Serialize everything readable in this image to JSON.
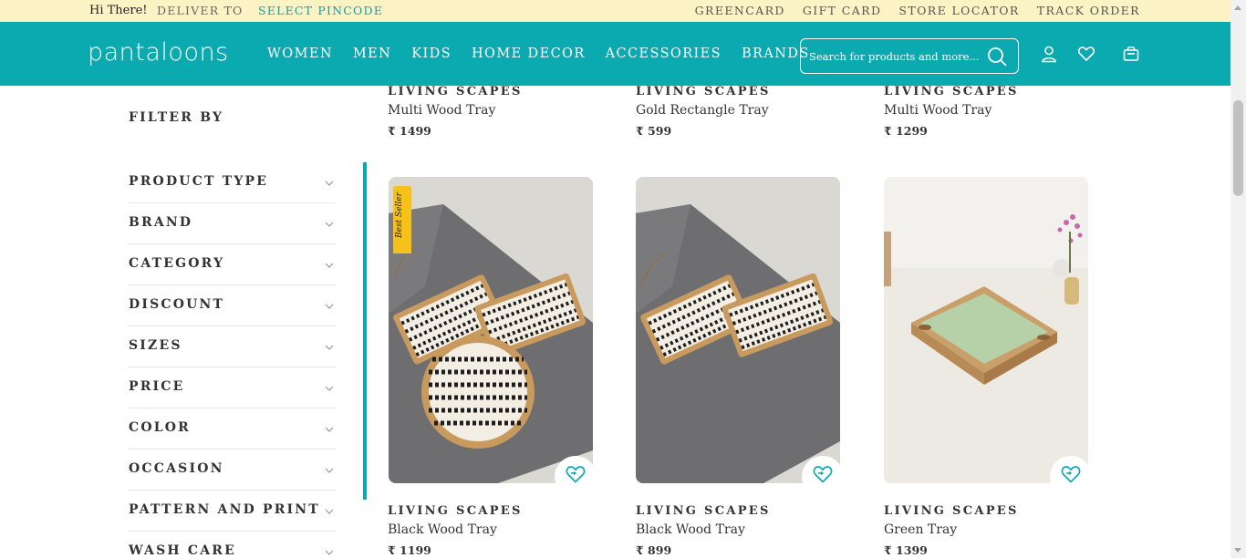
{
  "topbar": {
    "greeting": "Hi There!",
    "deliver_to": "DELIVER TO",
    "select_pincode": "SELECT PINCODE",
    "links": [
      "GREENCARD",
      "GIFT CARD",
      "STORE LOCATOR",
      "TRACK ORDER"
    ]
  },
  "nav": {
    "logo": "pantaloons",
    "menu": [
      "WOMEN",
      "MEN",
      "KIDS",
      "HOME DECOR",
      "ACCESSORIES",
      "BRANDS"
    ],
    "search_placeholder": "Search for products and more..."
  },
  "filters": {
    "title": "FILTER BY",
    "items": [
      "PRODUCT TYPE",
      "BRAND",
      "CATEGORY",
      "DISCOUNT",
      "SIZES",
      "PRICE",
      "COLOR",
      "OCCASION",
      "PATTERN AND PRINT",
      "WASH CARE"
    ]
  },
  "products_top": [
    {
      "brand": "LIVING SCAPES",
      "name": "Multi Wood Tray",
      "price": "₹ 1499"
    },
    {
      "brand": "LIVING SCAPES",
      "name": "Gold Rectangle Tray",
      "price": "₹ 599"
    },
    {
      "brand": "LIVING SCAPES",
      "name": "Multi Wood Tray",
      "price": "₹ 1299"
    }
  ],
  "products": [
    {
      "brand": "LIVING SCAPES",
      "name": "Black Wood Tray",
      "price": "₹ 1199",
      "badge": "Best Seller"
    },
    {
      "brand": "LIVING SCAPES",
      "name": "Black Wood Tray",
      "price": "₹ 899"
    },
    {
      "brand": "LIVING SCAPES",
      "name": "Green Tray",
      "price": "₹ 1399"
    }
  ],
  "colors": {
    "accent": "#0ba9b0",
    "topbar": "#fcf3c4",
    "badge": "#f6c21a"
  }
}
